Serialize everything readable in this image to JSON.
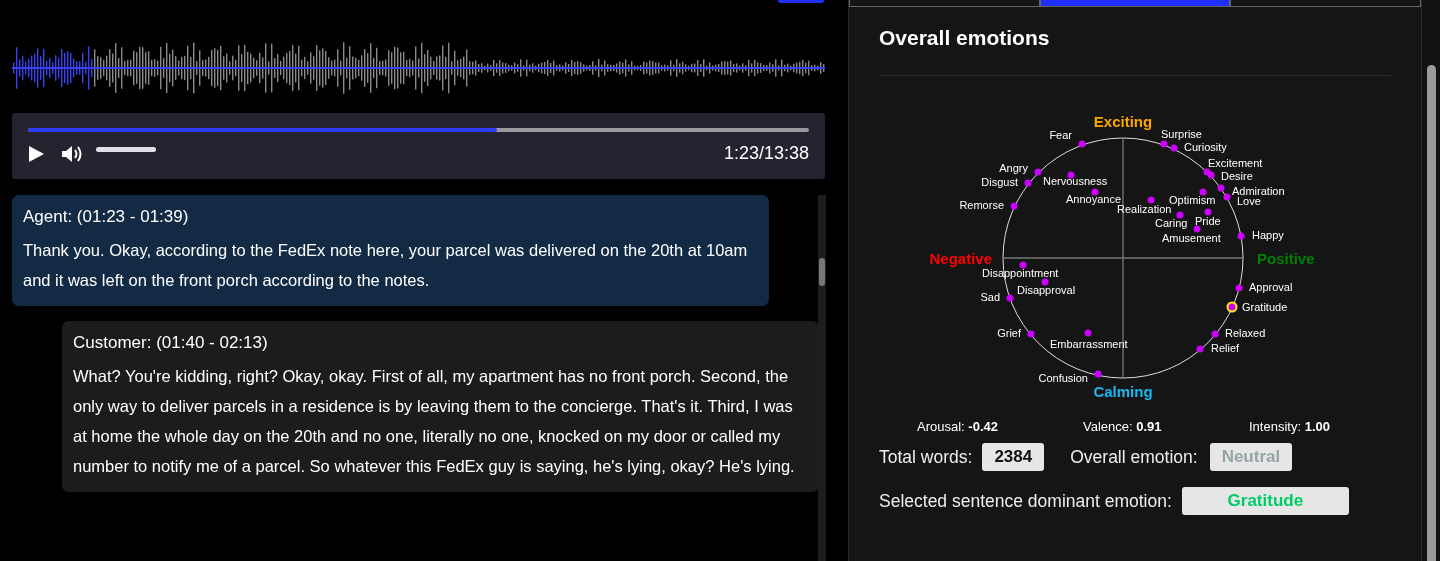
{
  "tabs": [
    {
      "selected": false
    },
    {
      "selected": true
    },
    {
      "selected": false
    }
  ],
  "player": {
    "progress": {
      "level": 0.6
    },
    "time": "1:23/13:38"
  },
  "transcript": [
    {
      "kind": "agent",
      "selected": true,
      "header": "Agent: (01:23 - 01:39)",
      "text": "Thank you. Okay, according to the FedEx note here, your parcel was delivered on the 20th at 10am and it was left on the front porch according to the notes."
    },
    {
      "kind": "customer",
      "selected": false,
      "header": "Customer: (01:40 - 02:13)",
      "text": "What? You're kidding, right? Okay, okay. First of all, my apartment has no front porch. Second, the only way to deliver parcels in a residence is by leaving them to the concierge. That's it. Third, I was at home the whole day on the 20th and no one, literally no one, knocked on my door or called my number to notify me of a parcel. So whatever this FedEx guy is saying, he's lying, okay? He's lying."
    }
  ],
  "emotions": {
    "title": "Overall emotions",
    "axes": [
      {
        "label": "Exciting",
        "color": "#ffa500"
      },
      {
        "label": "Negative",
        "color": "#ff0000"
      },
      {
        "label": "Positive",
        "color": "#008000"
      },
      {
        "label": "Calming",
        "color": "#1ab8f0"
      }
    ],
    "points": [
      {
        "label": "Fear",
        "selected": false
      },
      {
        "label": "Surprise",
        "selected": false
      },
      {
        "label": "Curiosity",
        "selected": false
      },
      {
        "label": "Excitement",
        "selected": false
      },
      {
        "label": "Angry",
        "selected": false
      },
      {
        "label": "Desire",
        "selected": false
      },
      {
        "label": "Disgust",
        "selected": false
      },
      {
        "label": "Nervousness",
        "selected": false
      },
      {
        "label": "Admiration",
        "selected": false
      },
      {
        "label": "Annoyance",
        "selected": false
      },
      {
        "label": "Optimism",
        "selected": false
      },
      {
        "label": "Love",
        "selected": false
      },
      {
        "label": "Remorse",
        "selected": false
      },
      {
        "label": "Realization",
        "selected": false
      },
      {
        "label": "Caring",
        "selected": false
      },
      {
        "label": "Pride",
        "selected": false
      },
      {
        "label": "Happy",
        "selected": false
      },
      {
        "label": "Amusement",
        "selected": false
      },
      {
        "label": "Disappointment",
        "selected": false
      },
      {
        "label": "Approval",
        "selected": false
      },
      {
        "label": "Disapproval",
        "selected": false
      },
      {
        "label": "Sad",
        "selected": false
      },
      {
        "label": "Gratitude",
        "selected": true
      },
      {
        "label": "Grief",
        "selected": false
      },
      {
        "label": "Relaxed",
        "selected": false
      },
      {
        "label": "Embarrassment",
        "selected": false
      },
      {
        "label": "Relief",
        "selected": false
      },
      {
        "label": "Confusion",
        "selected": false
      }
    ],
    "stats": [
      {
        "label": "Arousal:",
        "value": "-0.42"
      },
      {
        "label": "Valence:",
        "value": "0.91"
      },
      {
        "label": "Intensity:",
        "value": "1.00"
      }
    ],
    "total_words": {
      "label": "Total words:",
      "value": "2384"
    },
    "overall_emotion": {
      "label": "Overall emotion:",
      "value": "Neutral"
    },
    "dominant_emotion": {
      "label": "Selected sentence dominant emotion:",
      "value": "Gratitude"
    }
  }
}
